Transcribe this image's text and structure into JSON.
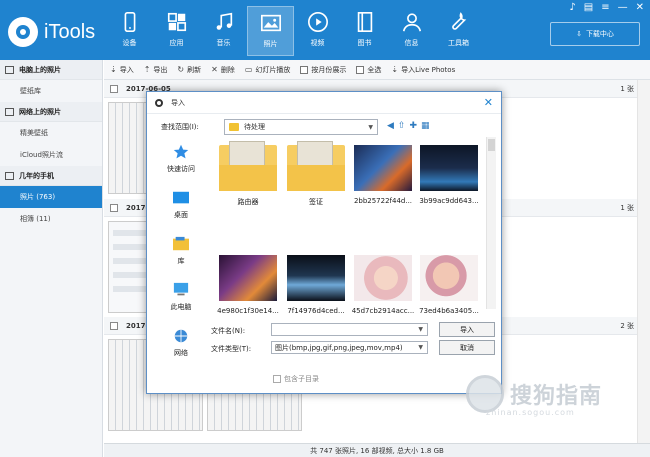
{
  "app": {
    "name": "iTools"
  },
  "nav": [
    {
      "label": "设备",
      "icon": "phone-icon"
    },
    {
      "label": "应用",
      "icon": "apps-icon"
    },
    {
      "label": "音乐",
      "icon": "music-icon"
    },
    {
      "label": "照片",
      "icon": "photo-icon",
      "active": true
    },
    {
      "label": "视频",
      "icon": "video-icon"
    },
    {
      "label": "图书",
      "icon": "book-icon"
    },
    {
      "label": "信息",
      "icon": "person-icon"
    },
    {
      "label": "工具箱",
      "icon": "wrench-icon"
    }
  ],
  "download": {
    "label": "下载中心"
  },
  "sidebar": {
    "groups": [
      {
        "title": "电脑上的照片",
        "items": [
          {
            "label": "壁纸库"
          }
        ]
      },
      {
        "title": "网络上的照片",
        "items": [
          {
            "label": "精美壁纸"
          },
          {
            "label": "iCloud照片流"
          }
        ]
      },
      {
        "title": "几年的手机",
        "items": [
          {
            "label": "照片 (763)",
            "selected": true
          },
          {
            "label": "相簿 (11)"
          }
        ]
      }
    ]
  },
  "toolbar": {
    "import": "导入",
    "export": "导出",
    "refresh": "刷新",
    "delete": "删除",
    "slideshow": "幻灯片播放",
    "by_month": "按月份展示",
    "select_all": "全选",
    "import_live": "导入Live Photos"
  },
  "content": {
    "groups": [
      {
        "date": "2017-06-05",
        "count": "1 张"
      },
      {
        "date": "2017-",
        "count": "1 张"
      },
      {
        "date": "2017-",
        "count": "2 张"
      }
    ]
  },
  "status": {
    "text": "共 747 张照片, 16 部视频, 总大小 1.8 GB"
  },
  "dialog": {
    "title": "导入",
    "lookin_label": "查找范围(I):",
    "lookin_value": "待处理",
    "places": [
      "快速访问",
      "桌面",
      "库",
      "此电脑",
      "网络"
    ],
    "files": [
      {
        "name": "路由器",
        "type": "folder"
      },
      {
        "name": "签证",
        "type": "folder"
      },
      {
        "name": "2bb25722f44d...",
        "type": "image"
      },
      {
        "name": "3b99ac9dd643...",
        "type": "image"
      },
      {
        "name": "4e980c1f30e14...",
        "type": "image"
      },
      {
        "name": "7f14976d4ced...",
        "type": "image"
      },
      {
        "name": "45d7cb2914acc...",
        "type": "image"
      },
      {
        "name": "73ed4b6a3405...",
        "type": "image"
      }
    ],
    "filename_label": "文件名(N):",
    "filename_value": "",
    "filetype_label": "文件类型(T):",
    "filetype_value": "图片(bmp,jpg,gif,png,jpeg,mov,mp4)",
    "ok": "导入",
    "cancel": "取消",
    "include_subdirs": "包含子目录"
  },
  "watermark": {
    "text": "搜狗指南",
    "sub": "zhinan.sogou.com"
  }
}
